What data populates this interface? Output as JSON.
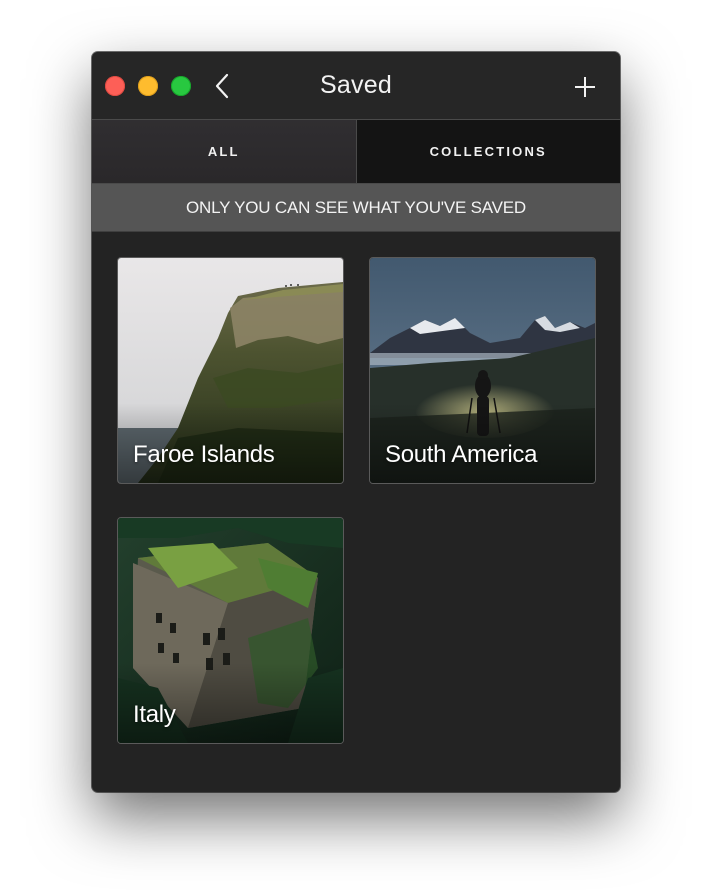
{
  "window": {
    "title": "Saved",
    "controls": [
      "close",
      "minimize",
      "zoom"
    ],
    "back_icon": "chevron-left-icon",
    "add_icon": "plus-icon"
  },
  "tabs": [
    {
      "label": "ALL",
      "selected": true
    },
    {
      "label": "COLLECTIONS",
      "selected": false
    }
  ],
  "notice": "ONLY YOU CAN SEE WHAT YOU'VE SAVED",
  "collections": [
    {
      "name": "Faroe Islands"
    },
    {
      "name": "South America"
    },
    {
      "name": "Italy"
    }
  ],
  "colors": {
    "window_bg": "#232323",
    "notice_bg": "#555555",
    "selected_tab_bg": "#2e2c2e",
    "unselected_tab_bg": "#141414",
    "close": "#fd5f57",
    "minimize": "#febc2e",
    "zoom": "#28c840"
  }
}
